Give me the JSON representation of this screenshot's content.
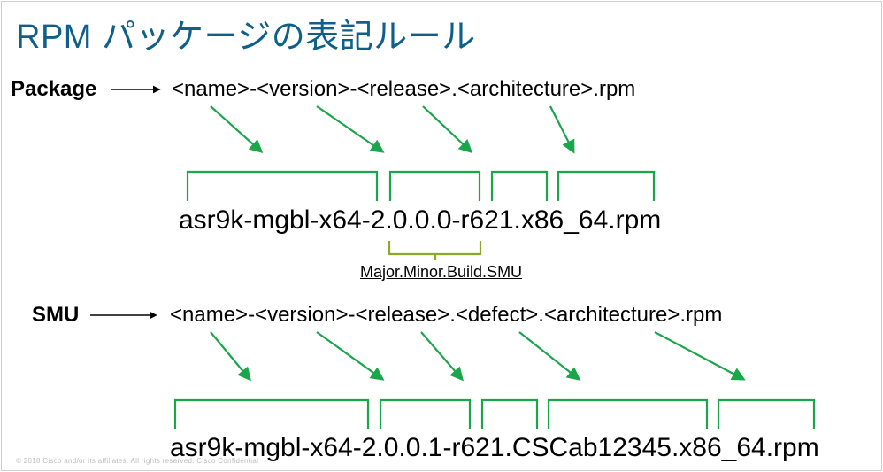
{
  "title": "RPM パッケージの表記ルール",
  "package": {
    "label": "Package",
    "pattern": "<name>-<version>-<release>.<architecture>.rpm",
    "example": "asr9k-mgbl-x64-2.0.0.0-r621.x86_64.rpm",
    "version_legend": "Major.Minor.Build.SMU"
  },
  "smu": {
    "label": "SMU",
    "pattern": "<name>-<version>-<release>.<defect>.<architecture>.rpm",
    "example": "asr9k-mgbl-x64-2.0.0.1-r621.CSCab12345.x86_64.rpm"
  },
  "footer": "© 2018  Cisco and/or its affiliates. All rights reserved.   Cisco Confidential",
  "colors": {
    "green": "#1aa64b",
    "olive": "#8aa82a",
    "title": "#0e5f8a"
  }
}
